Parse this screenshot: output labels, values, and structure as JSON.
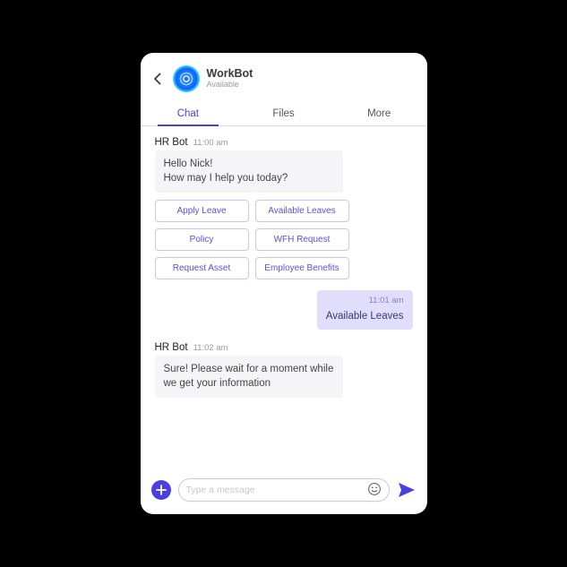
{
  "header": {
    "title": "WorkBot",
    "status": "Available"
  },
  "tabs": [
    {
      "label": "Chat",
      "active": true
    },
    {
      "label": "Files",
      "active": false
    },
    {
      "label": "More",
      "active": false
    }
  ],
  "messages": {
    "bot1": {
      "who": "HR Bot",
      "ts": "11:00 am",
      "lines": [
        "Hello Nick!",
        "How may I help you today?"
      ]
    },
    "chips": [
      "Apply Leave",
      "Available Leaves",
      "Policy",
      "WFH Request",
      "Request Asset",
      "Employee Benefits"
    ],
    "user1": {
      "ts": "11:01 am",
      "text": "Available Leaves"
    },
    "bot2": {
      "who": "HR Bot",
      "ts": "11:02 am",
      "text": "Sure! Please wait for a moment while we get your information"
    }
  },
  "composer": {
    "placeholder": "Type a message"
  },
  "colors": {
    "accent": "#4a3fe0"
  }
}
